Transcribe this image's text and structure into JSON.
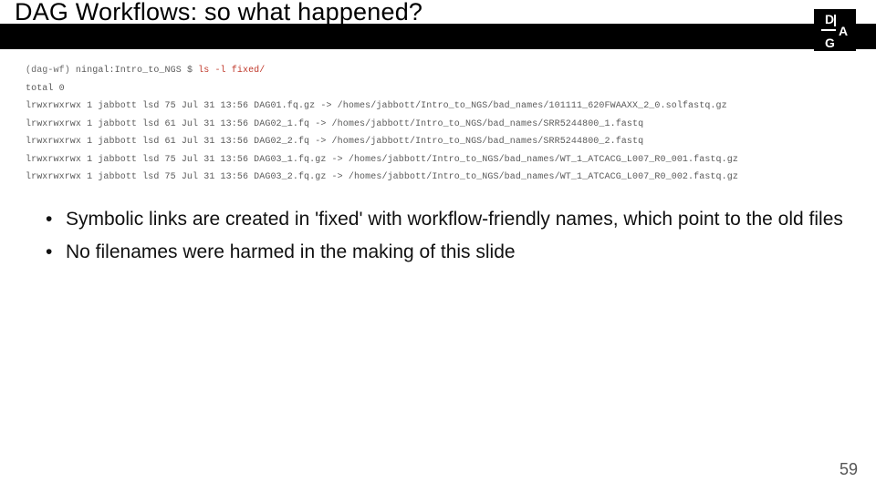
{
  "title": "DAG Workflows: so what happened?",
  "logo": {
    "letters": [
      "D",
      "A",
      "G"
    ]
  },
  "terminal": {
    "prompt_env": "(dag-wf) ",
    "prompt_path": "ningal:Intro_to_NGS $ ",
    "command": "ls -l fixed/",
    "total_line": "total 0",
    "rows": [
      "lrwxrwxrwx 1 jabbott lsd 75 Jul 31 13:56 DAG01.fq.gz -> /homes/jabbott/Intro_to_NGS/bad_names/101111_620FWAAXX_2_0.solfastq.gz",
      "lrwxrwxrwx 1 jabbott lsd 61 Jul 31 13:56 DAG02_1.fq -> /homes/jabbott/Intro_to_NGS/bad_names/SRR5244800_1.fastq",
      "lrwxrwxrwx 1 jabbott lsd 61 Jul 31 13:56 DAG02_2.fq -> /homes/jabbott/Intro_to_NGS/bad_names/SRR5244800_2.fastq",
      "lrwxrwxrwx 1 jabbott lsd 75 Jul 31 13:56 DAG03_1.fq.gz -> /homes/jabbott/Intro_to_NGS/bad_names/WT_1_ATCACG_L007_R0_001.fastq.gz",
      "lrwxrwxrwx 1 jabbott lsd 75 Jul 31 13:56 DAG03_2.fq.gz -> /homes/jabbott/Intro_to_NGS/bad_names/WT_1_ATCACG_L007_R0_002.fastq.gz"
    ]
  },
  "bullets": [
    "Symbolic links are created in 'fixed' with workflow-friendly names, which point to the old files",
    "No filenames were harmed in the making of this slide"
  ],
  "page_number": "59"
}
